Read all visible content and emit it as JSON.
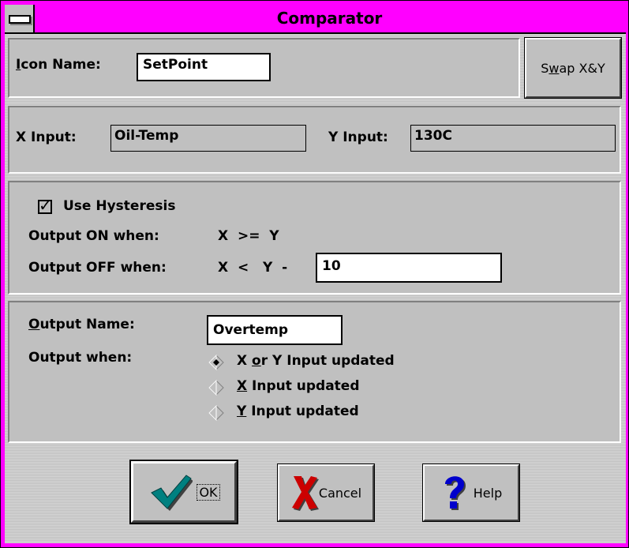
{
  "window": {
    "title": "Comparator"
  },
  "icon_name": {
    "label_prefix": "I",
    "label_rest": "con Name:",
    "value": "SetPoint"
  },
  "swap_button": {
    "label_pre": "S",
    "label_accel": "w",
    "label_post": "ap X&Y"
  },
  "inputs": {
    "x_label": "X Input:",
    "x_value": "Oil-Temp",
    "y_label": "Y Input:",
    "y_value": "130C"
  },
  "hysteresis": {
    "checkbox_label": "Use Hysteresis",
    "checked": true,
    "check_mark": "✓",
    "on_label": "Output ON when:",
    "on_expr": "X  >=  Y",
    "off_label": "Output OFF when:",
    "off_expr": "X  <   Y  -",
    "off_value": "10"
  },
  "output": {
    "name_label_accel": "O",
    "name_label_rest": "utput Name:",
    "name_value": "Overtemp",
    "when_label": "Output when:",
    "options": [
      {
        "pre": "X ",
        "accel": "o",
        "post": "r Y Input updated",
        "selected": true
      },
      {
        "pre": "",
        "accel": "X",
        "post": " Input updated",
        "selected": false
      },
      {
        "pre": "",
        "accel": "Y",
        "post": " Input updated",
        "selected": false
      }
    ]
  },
  "buttons": {
    "ok": {
      "label": "OK",
      "icon": "checkmark-icon",
      "color": "#008080"
    },
    "cancel": {
      "label": "Cancel",
      "icon": "x-icon",
      "color": "#cc0000"
    },
    "help": {
      "label": "Help",
      "icon": "question-icon",
      "color": "#0000cc"
    }
  },
  "colors": {
    "titlebar": "#ff00ff",
    "face": "#c0c0c0"
  }
}
